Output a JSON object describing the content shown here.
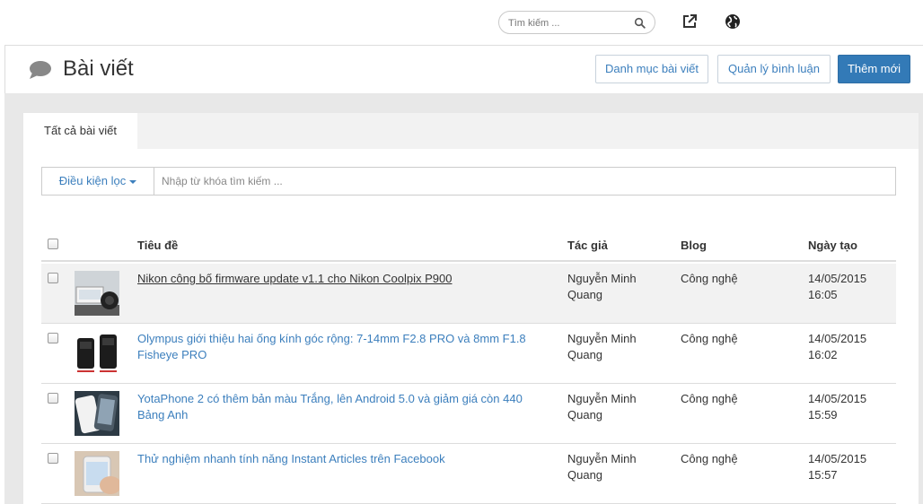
{
  "topbar": {
    "search_placeholder": "Tìm kiếm ...",
    "icons": [
      "search-icon",
      "external-link-icon",
      "globe-icon"
    ]
  },
  "header": {
    "title": "Bài viết",
    "title_icon": "comment-icon",
    "buttons": {
      "categories": "Danh mục bài viết",
      "comments": "Quản lý bình luận",
      "add_new": "Thêm mới"
    }
  },
  "tabs": [
    {
      "label": "Tất cả bài viết",
      "active": true
    }
  ],
  "filter": {
    "button_label": "Điều kiện lọc",
    "placeholder": "Nhập từ khóa tìm kiếm ..."
  },
  "table": {
    "columns": {
      "title": "Tiêu đề",
      "author": "Tác giả",
      "blog": "Blog",
      "created": "Ngày tạo"
    },
    "rows": [
      {
        "title": "Nikon công bố firmware update v1.1 cho Nikon Coolpix P900",
        "author": "Nguyễn Minh Quang",
        "blog": "Công nghệ",
        "date": "14/05/2015",
        "time": "16:05"
      },
      {
        "title": "Olympus giới thiệu hai ống kính góc rộng: 7-14mm F2.8 PRO và 8mm F1.8 Fisheye PRO",
        "author": "Nguyễn Minh Quang",
        "blog": "Công nghệ",
        "date": "14/05/2015",
        "time": "16:02"
      },
      {
        "title": "YotaPhone 2 có thêm bản màu Trắng, lên Android 5.0 và giảm giá còn 440 Bảng Anh",
        "author": "Nguyễn Minh Quang",
        "blog": "Công nghệ",
        "date": "14/05/2015",
        "time": "15:59"
      },
      {
        "title": "Thử nghiệm nhanh tính năng Instant Articles trên Facebook",
        "author": "Nguyễn Minh Quang",
        "blog": "Công nghệ",
        "date": "14/05/2015",
        "time": "15:57"
      }
    ]
  },
  "colors": {
    "accent": "#337ab7",
    "link": "#3c7fbd",
    "background": "#e8e8e8"
  }
}
